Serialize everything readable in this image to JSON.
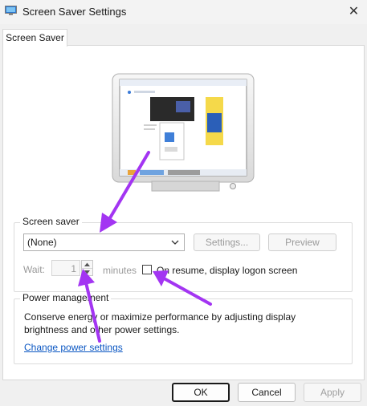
{
  "window": {
    "title": "Screen Saver Settings"
  },
  "tabs": [
    {
      "label": "Screen Saver"
    }
  ],
  "screen_saver": {
    "group_label": "Screen saver",
    "selected": "(None)",
    "settings_label": "Settings...",
    "preview_label": "Preview",
    "wait_label": "Wait:",
    "wait_value": "1",
    "minutes_label": "minutes",
    "logon_label": "On resume, display logon screen",
    "logon_checked": false
  },
  "power": {
    "group_label": "Power management",
    "description": "Conserve energy or maximize performance by adjusting display brightness and other power settings.",
    "link_label": "Change power settings"
  },
  "footer": {
    "ok_label": "OK",
    "cancel_label": "Cancel",
    "apply_label": "Apply"
  },
  "colors": {
    "link": "#0b57c3",
    "annotation_arrow": "#a335f2"
  }
}
